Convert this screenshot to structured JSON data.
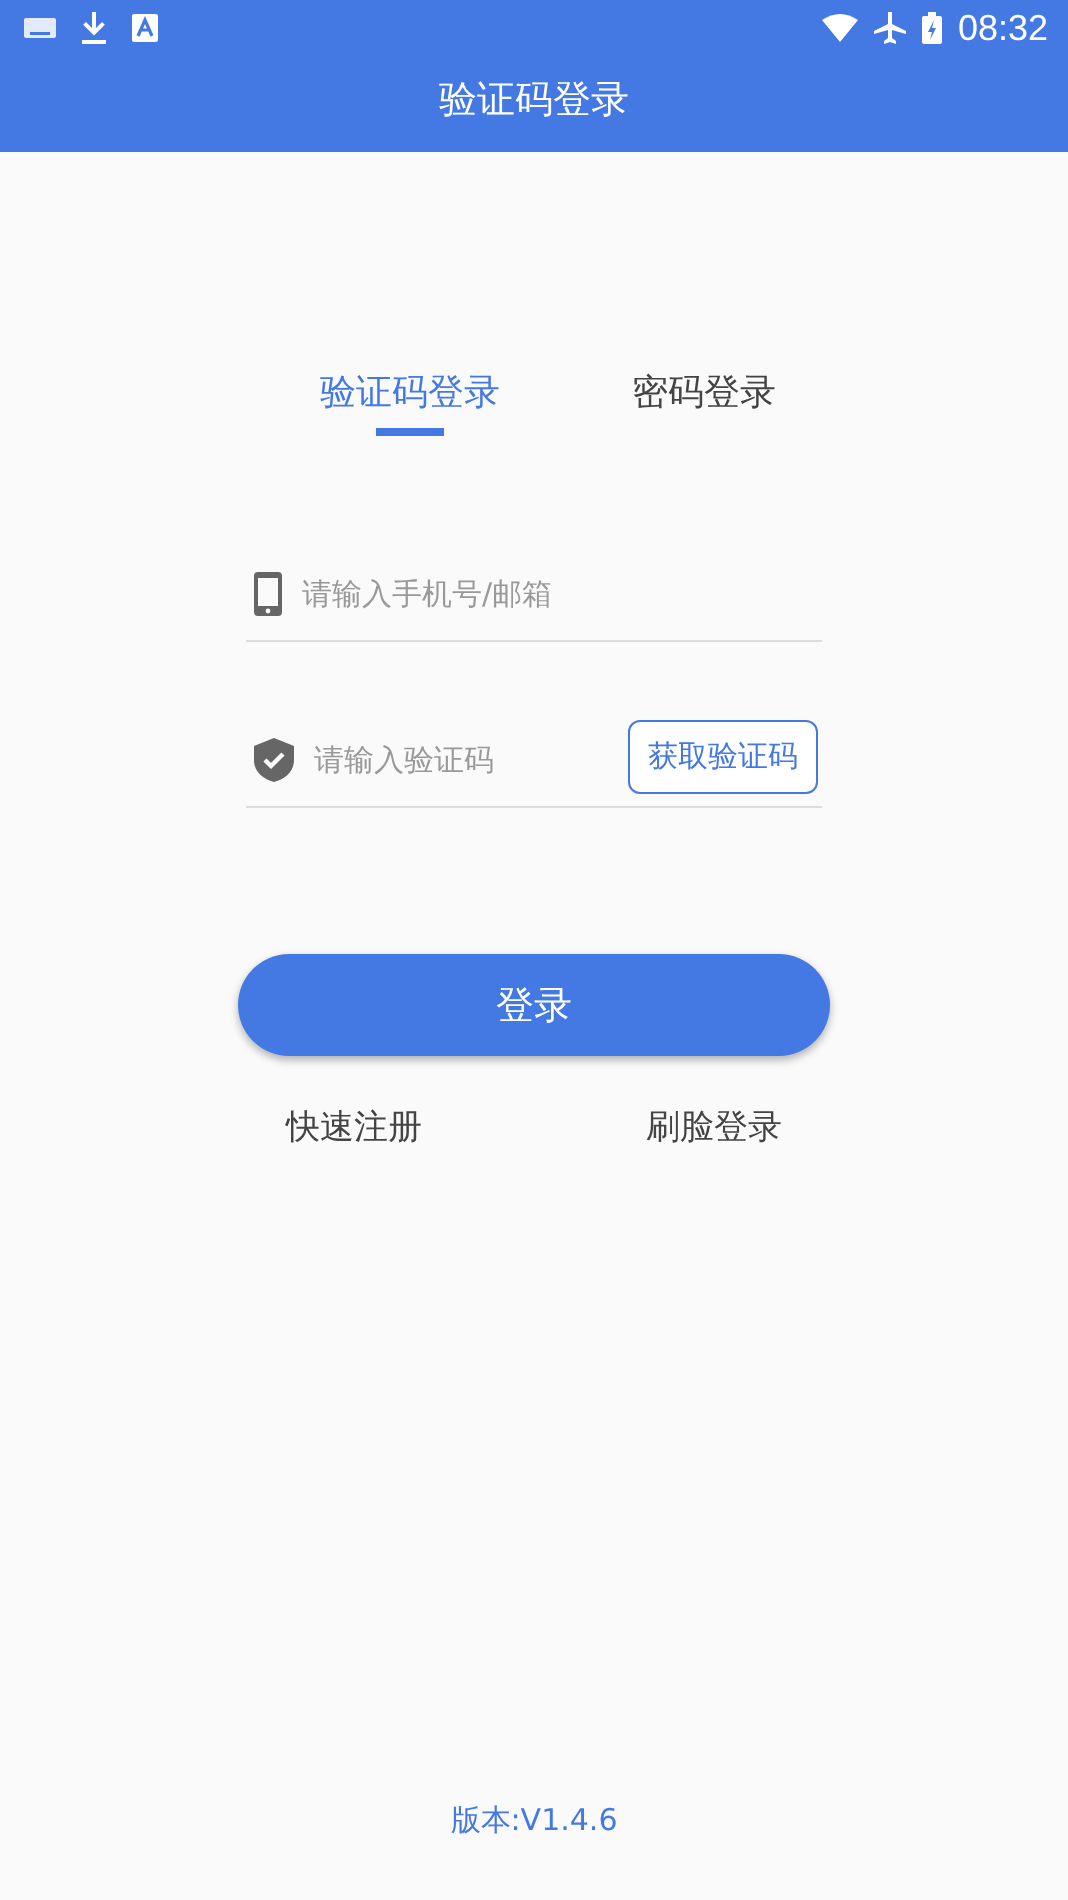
{
  "status_bar": {
    "time": "08:32"
  },
  "title": "验证码登录",
  "tabs": [
    {
      "label": "验证码登录",
      "selected": true
    },
    {
      "label": "密码登录",
      "selected": false
    }
  ],
  "account_field": {
    "placeholder": "请输入手机号/邮箱"
  },
  "code_field": {
    "placeholder": "请输入验证码"
  },
  "get_code_button": "获取验证码",
  "login_button": "登录",
  "links": [
    "快速注册",
    "刷脸登录"
  ],
  "version": "版本:V1.4.6"
}
